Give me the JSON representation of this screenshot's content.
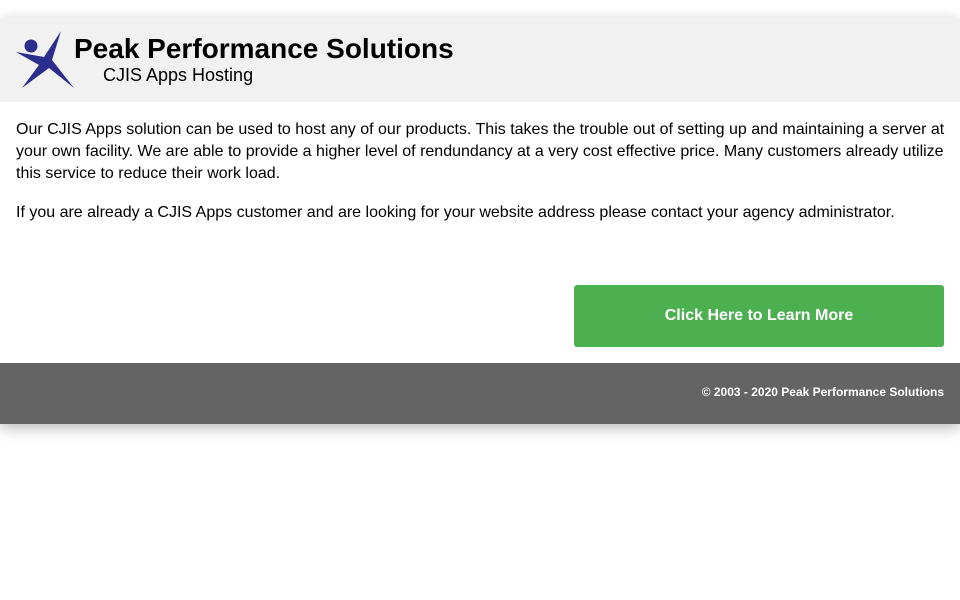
{
  "header": {
    "logo_icon": "leaping-figure-logo-icon",
    "company_name": "Peak Performance Solutions",
    "subtitle": "CJIS Apps Hosting",
    "brand_color": "#2b2e8c"
  },
  "main": {
    "paragraphs": [
      "Our CJIS Apps solution can be used to host any of our products. This takes the trouble out of setting up and maintaining a server at your own facility. We are able to provide a higher level of rendundancy at a very cost effective price. Many customers already utilize this service to reduce their work load.",
      "If you are already a CJIS Apps customer and are looking for your website address please contact your agency administrator."
    ],
    "cta_label": "Click Here to Learn More",
    "cta_color": "#4caf50"
  },
  "footer": {
    "copyright": "© 2003 - 2020 Peak Performance Solutions",
    "background_color": "#646464"
  }
}
